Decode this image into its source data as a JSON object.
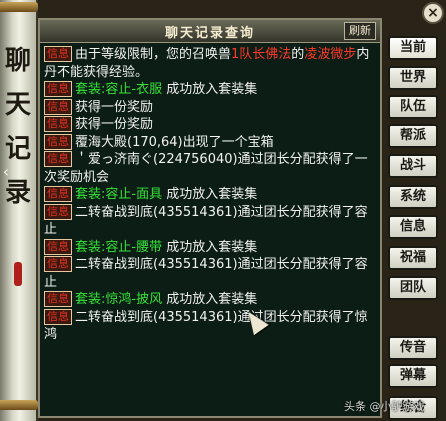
{
  "window": {
    "title": "聊天记录查询",
    "refresh_label": "刷新"
  },
  "banner": {
    "chars": [
      "聊",
      "天",
      "记",
      "录"
    ],
    "arrow": "‹"
  },
  "log": [
    {
      "tag": "信息",
      "segments": [
        {
          "text": "由于等级限制，您的召唤兽",
          "color": "white"
        },
        {
          "text": "1队长佛法",
          "color": "red"
        },
        {
          "text": "的",
          "color": "white"
        },
        {
          "text": "凌波",
          "color": "red"
        },
        {
          "text": "微步",
          "color": "red"
        },
        {
          "text": "内丹不能获得经验。",
          "color": "white"
        }
      ]
    },
    {
      "tag": "信息",
      "segments": [
        {
          "text": "套装:容止-衣服",
          "color": "green"
        },
        {
          "text": "  成功放入套装集",
          "color": "white"
        }
      ]
    },
    {
      "tag": "信息",
      "segments": [
        {
          "text": "获得一份奖励",
          "color": "white"
        }
      ]
    },
    {
      "tag": "信息",
      "segments": [
        {
          "text": "获得一份奖励",
          "color": "white"
        }
      ]
    },
    {
      "tag": "信息",
      "segments": [
        {
          "text": "覆海大殿(170,64)出现了一个宝箱",
          "color": "white"
        }
      ]
    },
    {
      "tag": "信息",
      "segments": [
        {
          "text": "＇爱っ济南ぐ(224756040)通过团长分配获得了一次奖励机会",
          "color": "white"
        }
      ]
    },
    {
      "tag": "信息",
      "segments": [
        {
          "text": "套装:容止-面具",
          "color": "green"
        },
        {
          "text": "  成功放入套装集",
          "color": "white"
        }
      ]
    },
    {
      "tag": "信息",
      "segments": [
        {
          "text": "二转奋战到底(435514361)通过团长分配获得了容止",
          "color": "white"
        }
      ]
    },
    {
      "tag": "信息",
      "segments": [
        {
          "text": "套装:容止-腰带",
          "color": "green"
        },
        {
          "text": "  成功放入套装集",
          "color": "white"
        }
      ]
    },
    {
      "tag": "信息",
      "segments": [
        {
          "text": "二转奋战到底(435514361)通过团长分配获得了容止",
          "color": "white"
        }
      ]
    },
    {
      "tag": "信息",
      "segments": [
        {
          "text": "套装:惊鸿-披风",
          "color": "green"
        },
        {
          "text": "  成功放入套装集",
          "color": "white"
        }
      ]
    },
    {
      "tag": "信息",
      "segments": [
        {
          "text": "二转奋战到底(435514361)通过团长分配获得了惊鸿",
          "color": "white"
        }
      ]
    }
  ],
  "side_buttons": [
    {
      "label": "当前",
      "name": "channel-current-button"
    },
    {
      "label": "世界",
      "name": "channel-world-button"
    },
    {
      "label": "队伍",
      "name": "channel-team-button"
    },
    {
      "label": "帮派",
      "name": "channel-guild-button"
    },
    {
      "label": "战斗",
      "name": "channel-battle-button"
    },
    {
      "label": "系统",
      "name": "channel-system-button"
    },
    {
      "label": "信息",
      "name": "channel-info-button"
    },
    {
      "label": "祝福",
      "name": "channel-blessing-button"
    },
    {
      "label": "团队",
      "name": "channel-group-button"
    },
    {
      "label": "传音",
      "name": "channel-voice-button"
    },
    {
      "label": "弹幕",
      "name": "channel-danmaku-button"
    },
    {
      "label": "综合",
      "name": "channel-all-button"
    }
  ],
  "close_label": "×",
  "watermark": "头条 @小驴游戏"
}
